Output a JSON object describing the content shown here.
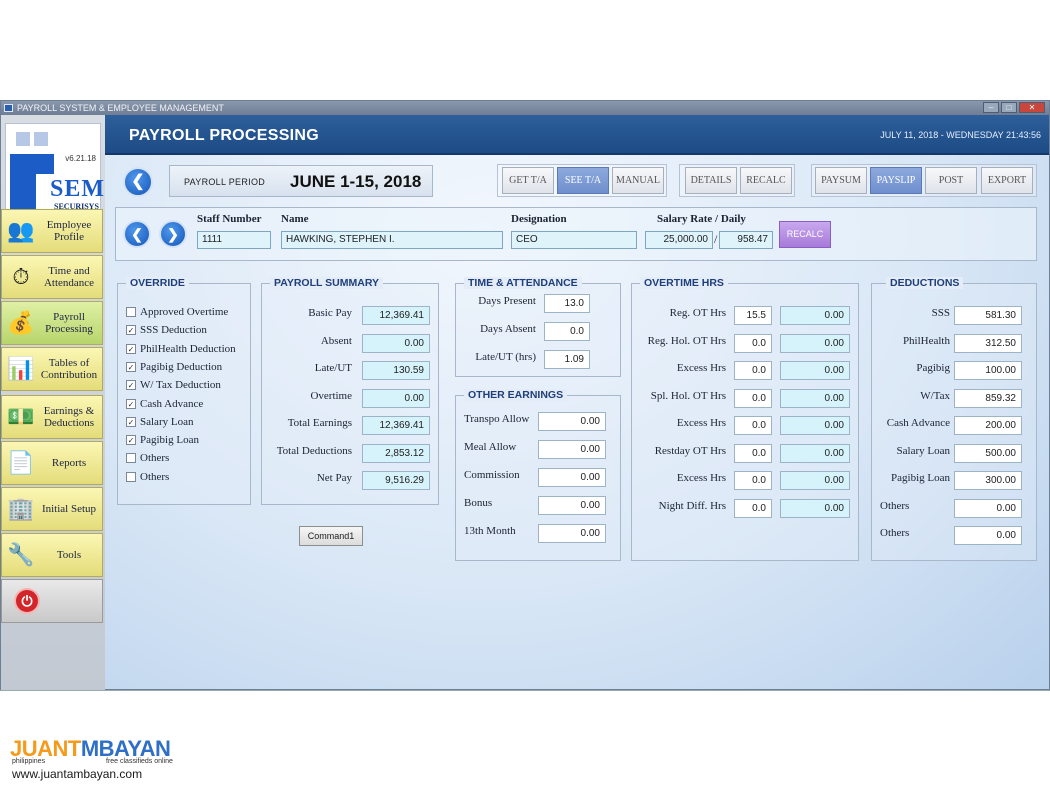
{
  "window": {
    "title": "PAYROLL SYSTEM & EMPLOYEE MANAGEMENT",
    "min": "–",
    "max": "□",
    "close": "✕"
  },
  "logo": {
    "version": "v6.21.18",
    "brand": "SEM",
    "company": "SECURISYS"
  },
  "sidebar": {
    "items": [
      {
        "label": "Employee Profile",
        "icon": "employee-profile-icon",
        "glyph": "👥"
      },
      {
        "label": "Time and Attendance",
        "icon": "clock-icon",
        "glyph": "⏱"
      },
      {
        "label": "Payroll Processing",
        "icon": "coins-icon",
        "glyph": "💰"
      },
      {
        "label": "Tables of Contribution",
        "icon": "table-icon",
        "glyph": "📊"
      },
      {
        "label": "Earnings & Deductions",
        "icon": "money-icon",
        "glyph": "💵"
      },
      {
        "label": "Reports",
        "icon": "report-icon",
        "glyph": "📄"
      },
      {
        "label": "Initial Setup",
        "icon": "building-icon",
        "glyph": "🏢"
      },
      {
        "label": "Tools",
        "icon": "tools-icon",
        "glyph": "🔧"
      }
    ],
    "active_index": 2,
    "power_glyph": "⏻"
  },
  "header": {
    "title": "PAYROLL PROCESSING",
    "datetime": "JULY 11, 2018 - WEDNESDAY 21:43:56"
  },
  "period": {
    "label": "PAYROLL PERIOD",
    "value": "JUNE 1-15, 2018",
    "back_glyph": "❮"
  },
  "toolbar": {
    "get_ta": "GET T/A",
    "see_ta": "SEE T/A",
    "manual": "MANUAL",
    "details": "DETAILS",
    "recalc": "RECALC",
    "paysum": "PAYSUM",
    "payslip": "PAYSLIP",
    "post": "POST",
    "export": "EXPORT"
  },
  "employee": {
    "prev_glyph": "❮",
    "next_glyph": "❯",
    "staff_number_label": "Staff Number",
    "staff_number": "1111",
    "name_label": "Name",
    "name": "HAWKING, STEPHEN I.",
    "designation_label": "Designation",
    "designation": "CEO",
    "salary_label": "Salary Rate / Daily",
    "salary_rate": "25,000.00",
    "daily_rate": "958.47",
    "recalc": "RECALC"
  },
  "override": {
    "title": "OVERRIDE",
    "items": [
      {
        "label": "Approved Overtime",
        "checked": false
      },
      {
        "label": "SSS Deduction",
        "checked": true
      },
      {
        "label": "PhilHealth Deduction",
        "checked": true
      },
      {
        "label": "Pagibig Deduction",
        "checked": true
      },
      {
        "label": "W/ Tax Deduction",
        "checked": true
      },
      {
        "label": "Cash Advance",
        "checked": true
      },
      {
        "label": "Salary Loan",
        "checked": true
      },
      {
        "label": "Pagibig Loan",
        "checked": true
      },
      {
        "label": "Others",
        "checked": false
      },
      {
        "label": "Others",
        "checked": false
      }
    ]
  },
  "summary": {
    "title": "PAYROLL SUMMARY",
    "rows": [
      {
        "label": "Basic Pay",
        "value": "12,369.41"
      },
      {
        "label": "Absent",
        "value": "0.00"
      },
      {
        "label": "Late/UT",
        "value": "130.59"
      },
      {
        "label": "Overtime",
        "value": "0.00"
      },
      {
        "label": "Total Earnings",
        "value": "12,369.41"
      },
      {
        "label": "Total Deductions",
        "value": "2,853.12"
      },
      {
        "label": "Net Pay",
        "value": "9,516.29"
      }
    ],
    "command": "Command1"
  },
  "attendance": {
    "title": "TIME & ATTENDANCE",
    "rows": [
      {
        "label": "Days Present",
        "value": "13.0"
      },
      {
        "label": "Days Absent",
        "value": "0.0"
      },
      {
        "label": "Late/UT (hrs)",
        "value": "1.09"
      }
    ]
  },
  "other_earnings": {
    "title": "OTHER EARNINGS",
    "rows": [
      {
        "label": "Transpo Allow",
        "value": "0.00"
      },
      {
        "label": "Meal Allow",
        "value": "0.00"
      },
      {
        "label": "Commission",
        "value": "0.00"
      },
      {
        "label": "Bonus",
        "value": "0.00"
      },
      {
        "label": "13th Month",
        "value": "0.00"
      }
    ]
  },
  "overtime": {
    "title": "OVERTIME HRS",
    "rows": [
      {
        "label": "Reg. OT Hrs",
        "hrs": "15.5",
        "amount": "0.00"
      },
      {
        "label": "Reg. Hol. OT Hrs",
        "hrs": "0.0",
        "amount": "0.00"
      },
      {
        "label": "Excess Hrs",
        "hrs": "0.0",
        "amount": "0.00"
      },
      {
        "label": "Spl. Hol. OT Hrs",
        "hrs": "0.0",
        "amount": "0.00"
      },
      {
        "label": "Excess Hrs",
        "hrs": "0.0",
        "amount": "0.00"
      },
      {
        "label": "Restday OT Hrs",
        "hrs": "0.0",
        "amount": "0.00"
      },
      {
        "label": "Excess Hrs",
        "hrs": "0.0",
        "amount": "0.00"
      },
      {
        "label": "Night Diff. Hrs",
        "hrs": "0.0",
        "amount": "0.00"
      }
    ]
  },
  "deductions": {
    "title": "DEDUCTIONS",
    "rows": [
      {
        "label": "SSS",
        "value": "581.30"
      },
      {
        "label": "PhilHealth",
        "value": "312.50"
      },
      {
        "label": "Pagibig",
        "value": "100.00"
      },
      {
        "label": "W/Tax",
        "value": "859.32"
      },
      {
        "label": "Cash Advance",
        "value": "200.00"
      },
      {
        "label": "Salary Loan",
        "value": "500.00"
      },
      {
        "label": "Pagibig Loan",
        "value": "300.00"
      },
      {
        "label": "Others",
        "value": "0.00"
      },
      {
        "label": "Others",
        "value": "0.00"
      }
    ]
  },
  "watermark": {
    "brand_a": "JUANT",
    "brand_b": "MBAYAN",
    "sub_a": "philippines",
    "sub_b": "free classifieds online",
    "url": "www.juantambayan.com"
  }
}
